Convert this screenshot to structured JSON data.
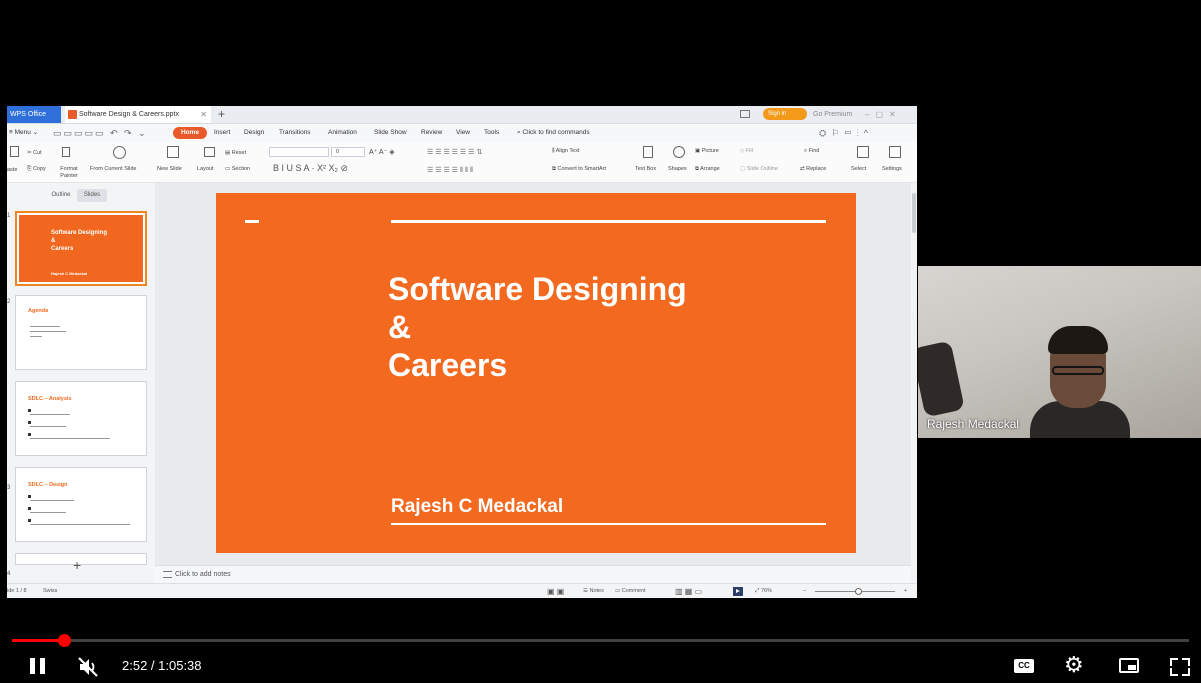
{
  "wps": {
    "home_tab": "WPS Office",
    "doc_tab": "Software Design & Careers.pptx",
    "new_tab": "+",
    "sign_in": "Sign in",
    "go_premium": "Go Premium",
    "menu": {
      "menu_label": "Menu",
      "tabs": [
        "Home",
        "Insert",
        "Design",
        "Transitions",
        "Animation",
        "Slide Show",
        "Review",
        "View",
        "Tools"
      ],
      "search": "Click to find commands"
    },
    "ribbon": {
      "cut": "Cut",
      "copy": "Copy",
      "paste": "aste",
      "format_painter": "Format Painter",
      "from_current_slide": "From Current Slide",
      "new_slide": "New Slide",
      "layout": "Layout",
      "reset": "Reset",
      "section": "Section",
      "font_size": "0",
      "align_text": "Align Text",
      "convert_to_smartart": "Convert to SmartArt",
      "text_box": "Text Box",
      "shapes": "Shapes",
      "picture": "Picture",
      "fill": "Fill",
      "arrange": "Arrange",
      "slide_outline": "Slide Outline",
      "find": "Find",
      "replace": "Replace",
      "select": "Select",
      "settings": "Settings"
    },
    "panel": {
      "outline_tab": "Outline",
      "slides_tab": "Slides",
      "add_slide": "+",
      "thumbs": [
        {
          "num": "1",
          "title": "Software Designing\n&\nCareers",
          "author": "Rajesh C Medackal"
        },
        {
          "num": "2",
          "title": "Agenda"
        },
        {
          "num": "3",
          "title": "SDLC – Analysis"
        },
        {
          "num": "4",
          "title": "SDLC – Design"
        },
        {
          "num": "5"
        }
      ]
    },
    "slide": {
      "title": "Software Designing\n&\nCareers",
      "author": "Rajesh C Medackal"
    },
    "notes_placeholder": "Click to add notes",
    "status": {
      "slide_count": "ide 1 / 8",
      "theme": "Swiss",
      "notes": "Notes",
      "comment": "Comment",
      "zoom": "76%",
      "zoom_minus": "−",
      "zoom_plus": "+"
    }
  },
  "webcam": {
    "participant_name": "Rajesh Medackal"
  },
  "player": {
    "current_time": "2:52",
    "duration": "1:05:38",
    "time_display": "2:52 / 1:05:38",
    "progress_fraction": 0.044,
    "cc_label": "CC",
    "colors": {
      "progress": "#ff0000",
      "slide": "#f2691f",
      "home_pill": "#e85a2a"
    }
  }
}
